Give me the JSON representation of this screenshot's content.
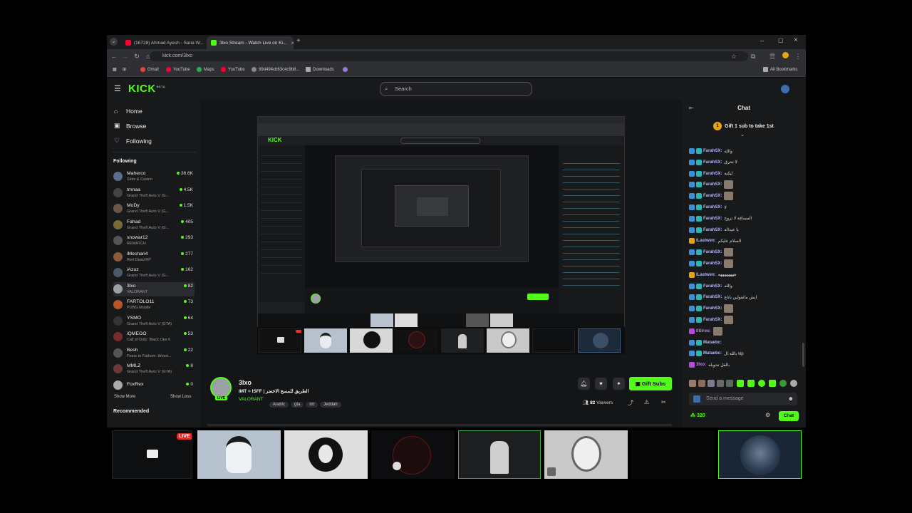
{
  "browser": {
    "tabs": [
      {
        "title": "(16728) Ahmad Ayesh - Sana W...",
        "favicon_color": "#ff0033"
      },
      {
        "title": "3lxo Stream - Watch Live on Ki...",
        "favicon_color": "#53fc18"
      }
    ],
    "url": "kick.com/3lxo",
    "bookmarks": [
      "Gmail",
      "YouTube",
      "Maps",
      "YouTube",
      "89d494cb63c4c9b8...",
      "Downloads"
    ],
    "all_bookmarks": "All Bookmarks"
  },
  "kick": {
    "logo": "KICK",
    "logo_beta": "BETA",
    "search_placeholder": "Search",
    "nav": {
      "home": "Home",
      "browse": "Browse",
      "following": "Following"
    },
    "following_heading": "Following",
    "following": [
      {
        "name": "Maherco",
        "game": "Slots & Casino",
        "viewers": "36.6K",
        "color": "#5a6e8a"
      },
      {
        "name": "tmnaa",
        "game": "Grand Theft Auto V (G...",
        "viewers": "4.5K",
        "color": "#444"
      },
      {
        "name": "MoDy",
        "game": "Grand Theft Auto V (G...",
        "viewers": "1.5K",
        "color": "#6a5646"
      },
      {
        "name": "Fahad",
        "game": "Grand Theft Auto V (G...",
        "viewers": "405",
        "color": "#7a6a3a"
      },
      {
        "name": "snowar12",
        "game": "REMATCH",
        "viewers": "293",
        "color": "#555"
      },
      {
        "name": "iMeshari4",
        "game": "Red Dead RP",
        "viewers": "277",
        "color": "#8a5a3a"
      },
      {
        "name": "iAzuz",
        "game": "Grand Theft Auto V (G...",
        "viewers": "162",
        "color": "#4a5a6a"
      },
      {
        "name": "3lxo",
        "game": "VALORANT",
        "viewers": "82",
        "color": "#9aa0a6"
      },
      {
        "name": "FARTOLO11",
        "game": "PUBG Mobile",
        "viewers": "73",
        "color": "#b8552a"
      },
      {
        "name": "YSMO",
        "game": "Grand Theft Auto V (GTA)",
        "viewers": "64",
        "color": "#333"
      },
      {
        "name": "iQMEGO",
        "game": "Call of Duty: Black Ops 6",
        "viewers": "53",
        "color": "#7a2a2a"
      },
      {
        "name": "Besh",
        "game": "Fears to Fathom: Wood...",
        "viewers": "22",
        "color": "#555"
      },
      {
        "name": "MMLZ",
        "game": "Grand Theft Auto V (GTA)",
        "viewers": "8",
        "color": "#6a3a3a"
      },
      {
        "name": "FoxRex",
        "game": "",
        "viewers": "0",
        "color": "#aaa"
      }
    ],
    "show_more": "Show More",
    "show_less": "Show Less",
    "recommended": "Recommended",
    "stream": {
      "channel": "3lxo",
      "title": "IMT = ISFF | الطريق للمسح الاخضر",
      "live_badge": "LIVE",
      "category": "VALORANT",
      "tags": [
        "Arabic",
        "gta",
        "mt",
        "Jeddah"
      ],
      "viewers": "82",
      "viewers_label": "Viewers",
      "gift_subs": "Gift Subs"
    },
    "chat": {
      "title": "Chat",
      "gift_banner": "Gift 1 sub to take 1st",
      "messages": [
        {
          "user": "FarahSX:",
          "msg": "والله",
          "color": "#b7b7f7",
          "emote": false
        },
        {
          "user": "FarahSX:",
          "msg": "لا تحرق",
          "color": "#b7b7f7",
          "emote": false
        },
        {
          "user": "FarahSX:",
          "msg": "ليكيه",
          "color": "#b7b7f7",
          "emote": false
        },
        {
          "user": "FarahSX:",
          "msg": "",
          "color": "#b7b7f7",
          "emote": true
        },
        {
          "user": "FarahSX:",
          "msg": "",
          "color": "#b7b7f7",
          "emote": true
        },
        {
          "user": "FarahSX:",
          "msg": "لا",
          "color": "#b7b7f7",
          "emote": false
        },
        {
          "user": "FarahSX:",
          "msg": "المسافة لا تروح",
          "color": "#b7b7f7",
          "emote": false
        },
        {
          "user": "FarahSX:",
          "msg": "يا عيداله",
          "color": "#b7b7f7",
          "emote": false
        },
        {
          "user": "iLastwen:",
          "msg": "السلام عليكم",
          "color": "#b7b7f7",
          "emote": false
        },
        {
          "user": "FarahSX:",
          "msg": "",
          "color": "#b7b7f7",
          "emote": true
        },
        {
          "user": "FarahSX:",
          "msg": "",
          "color": "#b7b7f7",
          "emote": true
        },
        {
          "user": "iLastwen:",
          "msg": "ههههههههه",
          "color": "#b7b7f7",
          "emote": false
        },
        {
          "user": "FarahSX:",
          "msg": "والله",
          "color": "#b7b7f7",
          "emote": false
        },
        {
          "user": "FarahSX:",
          "msg": "ايش ماتقولين ياتاع",
          "color": "#b7b7f7",
          "emote": false
        },
        {
          "user": "FarahSX:",
          "msg": "",
          "color": "#b7b7f7",
          "emote": true
        },
        {
          "user": "FarahSX:",
          "msg": "",
          "color": "#b7b7f7",
          "emote": true
        },
        {
          "user": "0Sirou:",
          "msg": "",
          "color": "#c084fc",
          "emote": true
        },
        {
          "user": "Mataebc:",
          "msg": "",
          "color": "#b7b7f7",
          "emote": false
        },
        {
          "user": "Mataebc:",
          "msg": "بالله ال vip",
          "color": "#b7b7f7",
          "emote": false
        },
        {
          "user": "3lxo:",
          "msg": "بالقل تحويله",
          "color": "#c084fc",
          "emote": false
        }
      ],
      "input_placeholder": "Send a message",
      "points": "320",
      "send_label": "Chat"
    }
  },
  "bottom_strip": {
    "live_label": "LIVE"
  },
  "colors": {
    "accent": "#53fc18",
    "chat_user": "#b7b7f7"
  }
}
